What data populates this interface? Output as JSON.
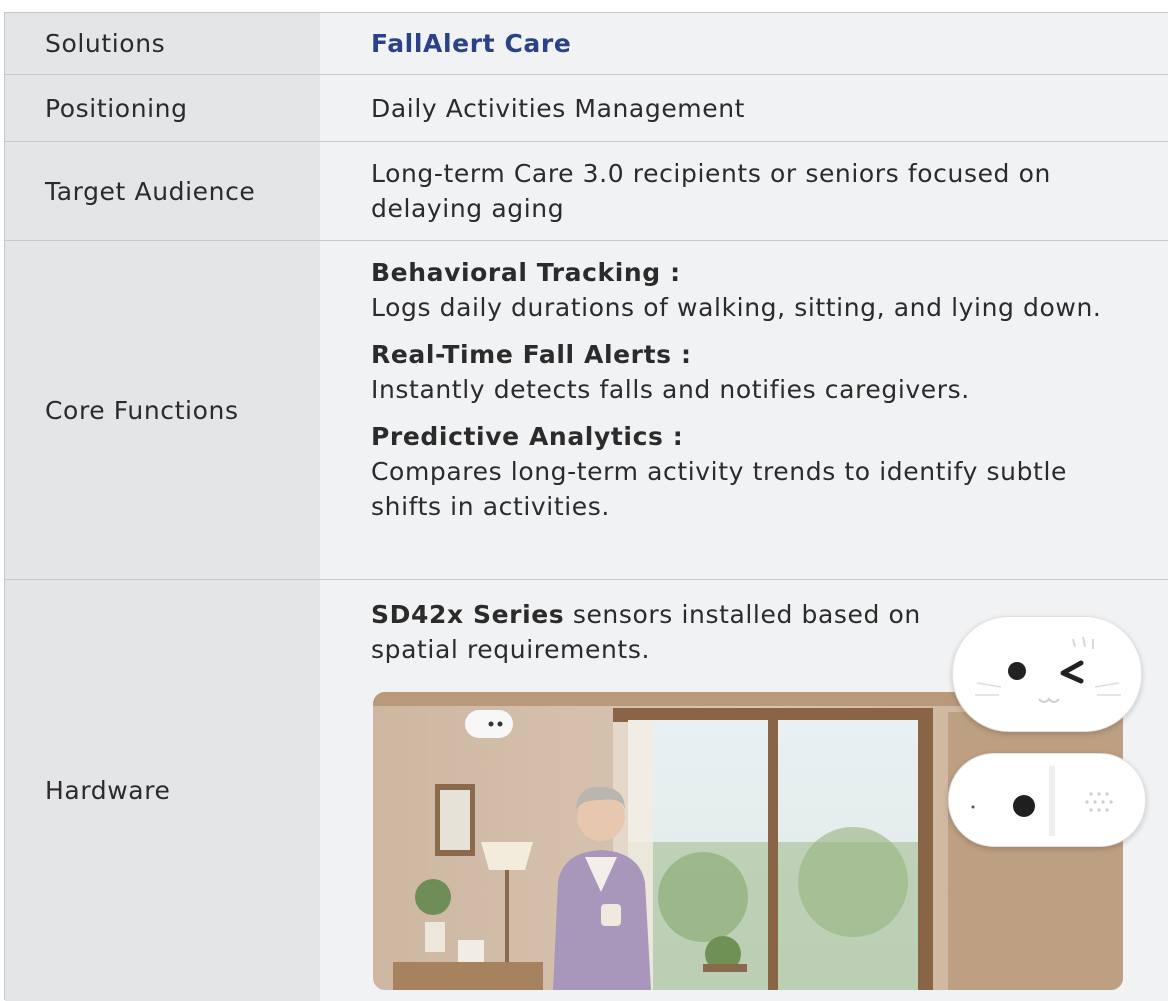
{
  "rows": {
    "solutions": {
      "label": "Solutions",
      "value": "FallAlert Care"
    },
    "positioning": {
      "label": "Positioning",
      "value": "Daily Activities Management"
    },
    "target": {
      "label": "Target Audience",
      "value": "Long-term Care 3.0 recipients or seniors focused on delaying aging"
    },
    "core": {
      "label": "Core Functions",
      "items": [
        {
          "title": "Behavioral Tracking :",
          "desc": "Logs daily durations of walking, sitting, and lying down."
        },
        {
          "title": "Real-Time Fall Alerts :",
          "desc": "Instantly detects falls and notifies caregivers."
        },
        {
          "title": "Predictive Analytics :",
          "desc": "Compares long-term activity trends to identify subtle shifts in activities."
        }
      ]
    },
    "hardware": {
      "label": "Hardware",
      "series": "SD42x Series",
      "text": " sensors installed based on spatial requirements."
    }
  },
  "colors": {
    "brand": "#2c4288",
    "label_bg": "#e4e5e7",
    "value_bg": "#f1f2f4",
    "border": "#c6c8cc"
  },
  "icons": [
    "cat-face-sensor-icon",
    "round-sensor-icon"
  ]
}
